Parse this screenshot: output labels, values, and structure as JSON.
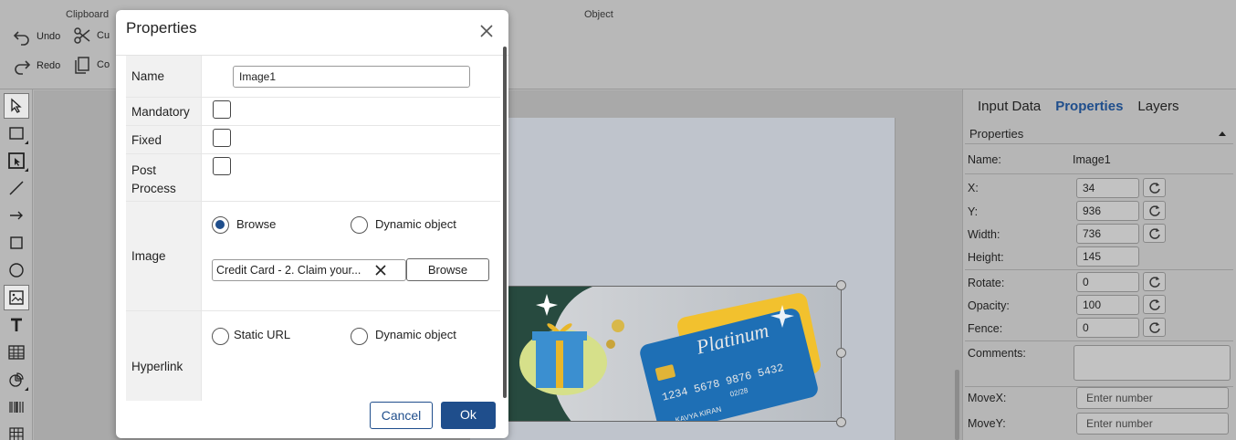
{
  "ribbon": {
    "clipboard_label": "Clipboard",
    "object_label": "Object",
    "undo_label": "Undo",
    "redo_label": "Redo",
    "cut_label": "Cu",
    "copy_label": "Co"
  },
  "banner": {
    "card_brand": "Platinum",
    "card_number": "1234 5678 9876 5432",
    "card_expiry": "02/28",
    "card_holder": "KAVYA KIRAN",
    "card_color": "#1e6fb5",
    "card_back_color": "#f2c12e"
  },
  "right_panel": {
    "tabs": [
      "Input Data",
      "Properties",
      "Layers"
    ],
    "active_tab": "Properties",
    "section_title": "Properties",
    "name_label": "Name:",
    "name_value": "Image1",
    "x_label": "X:",
    "x_value": "34",
    "y_label": "Y:",
    "y_value": "936",
    "width_label": "Width:",
    "width_value": "736",
    "height_label": "Height:",
    "height_value": "145",
    "rotate_label": "Rotate:",
    "rotate_value": "0",
    "opacity_label": "Opacity:",
    "opacity_value": "100",
    "fence_label": "Fence:",
    "fence_value": "0",
    "comments_label": "Comments:",
    "movex_label": "MoveX:",
    "movex_placeholder": "Enter number",
    "movey_label": "MoveY:",
    "movey_placeholder": "Enter number"
  },
  "dialog": {
    "title": "Properties",
    "name_label": "Name",
    "name_value": "Image1",
    "mandatory_label": "Mandatory",
    "fixed_label": "Fixed",
    "post_process_label_1": "Post",
    "post_process_label_2": "Process",
    "image_label": "Image",
    "browse_radio_label": "Browse",
    "dynamic_object_label": "Dynamic object",
    "file_name": "Credit Card - 2. Claim your...",
    "browse_button": "Browse",
    "hyperlink_label": "Hyperlink",
    "static_url_label": "Static URL",
    "hyperlink_dynamic_label": "Dynamic object",
    "cancel_button": "Cancel",
    "ok_button": "Ok"
  },
  "colors": {
    "accent": "#1f4e8c"
  }
}
